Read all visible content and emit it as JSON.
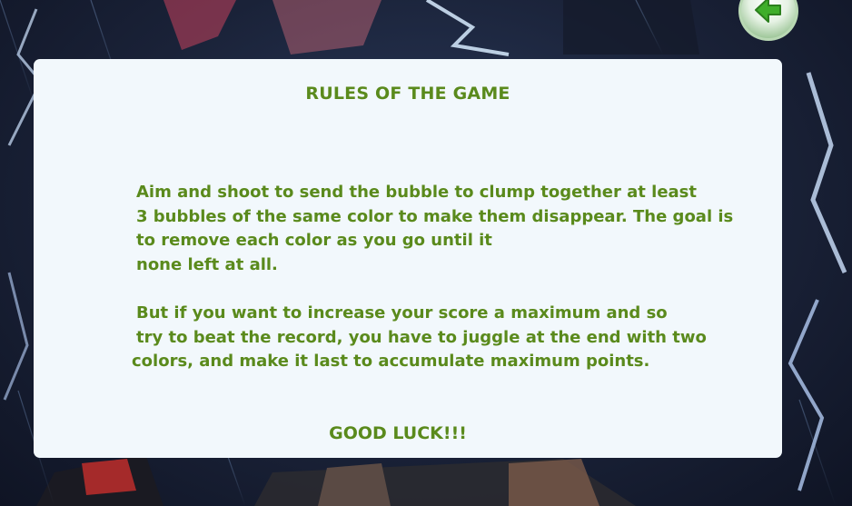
{
  "rules": {
    "title": "RULES OF THE GAME",
    "paragraph1": [
      "Aim and shoot to send the bubble to clump together at least",
      "3 bubbles of the same color to make them disappear. The goal is",
      "to remove each color as you go until it",
      "none left at all."
    ],
    "paragraph2": [
      "But if you want to increase your score a maximum and so",
      "try to beat the record, you have to juggle at the end with two",
      "colors, and make it last to accumulate maximum points."
    ],
    "closing": "GOOD LUCK!!!"
  },
  "colors": {
    "text_green": "#5a8a1c",
    "panel_bg": "#f2f8fc",
    "button_green": "#3fae2a"
  },
  "icons": {
    "back": "back-arrow-icon"
  }
}
